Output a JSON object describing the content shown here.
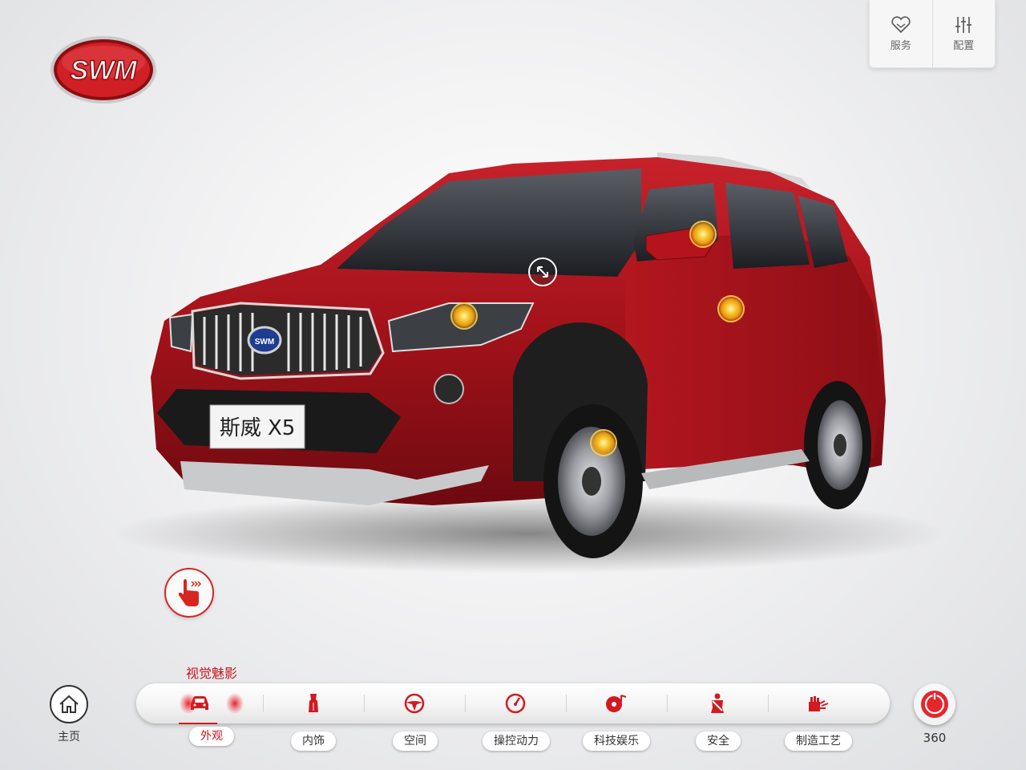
{
  "brand": {
    "logo_text": "SWM",
    "logo_icon": "swm-logo"
  },
  "top_panel": {
    "service": {
      "label": "服务",
      "icon": "heart-icon"
    },
    "config": {
      "label": "配置",
      "icon": "sliders-icon"
    }
  },
  "car": {
    "model_plate": "斯威 X5",
    "grille_badge": "SWM",
    "color": "#b3141d"
  },
  "section_title": "视觉魅影",
  "home": {
    "label": "主页",
    "icon": "home-icon"
  },
  "nav": {
    "active_index": 0,
    "items": [
      {
        "label": "外观",
        "icon": "car-icon"
      },
      {
        "label": "内饰",
        "icon": "seat-icon"
      },
      {
        "label": "空间",
        "icon": "steering-wheel-icon"
      },
      {
        "label": "操控动力",
        "icon": "speedometer-icon"
      },
      {
        "label": "科技娱乐",
        "icon": "music-disc-icon"
      },
      {
        "label": "安全",
        "icon": "seatbelt-icon"
      },
      {
        "label": "制造工艺",
        "icon": "robot-arm-icon"
      }
    ]
  },
  "view360": {
    "label": "360",
    "icon": "rotate-360-icon"
  },
  "colors": {
    "accent": "#d21a20",
    "text": "#333333"
  }
}
